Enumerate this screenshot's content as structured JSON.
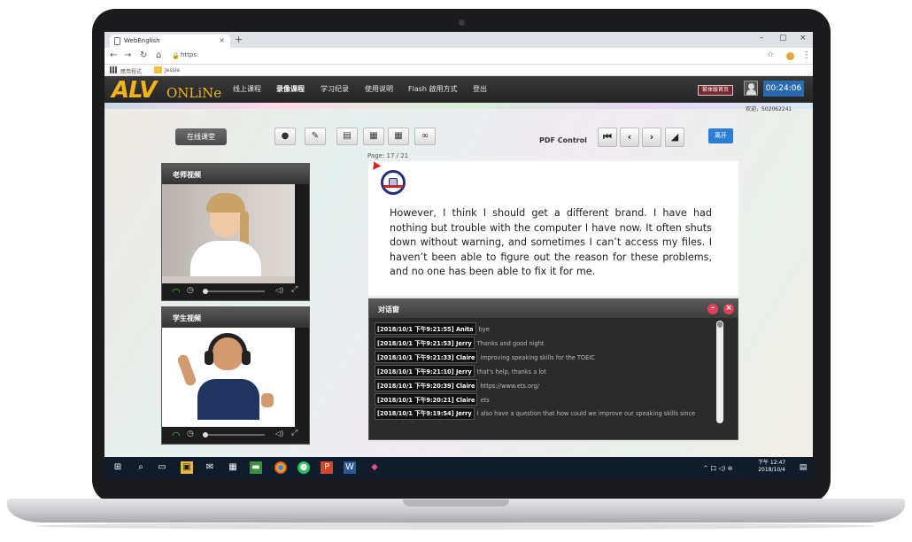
{
  "browser": {
    "tab_title": "WebEnglish",
    "tab_close": "×",
    "new_tab": "+",
    "window_controls": [
      "–",
      "▢",
      "×"
    ],
    "url": "https:",
    "bookmarks": [
      "應用程式",
      "Jessie"
    ]
  },
  "app": {
    "logo_main": "ALV",
    "logo_sub": "ONLiNe",
    "menu": [
      "线上课程",
      "录像课程",
      "学习纪录",
      "使用说明",
      "Flash 啟用方式",
      "登出"
    ],
    "active_menu": "录像课程",
    "home_button": "繁体版首页",
    "timer": "00:24:06",
    "welcome": "欢迎，502062241"
  },
  "toolbar": {
    "classroom_button": "在线课堂",
    "pdf_control_label": "PDF Control",
    "leave_button": "离开",
    "tool_icons": [
      "chat-icon",
      "pen-icon",
      "document-icon",
      "film-icon",
      "film-icon",
      "link-icon"
    ],
    "pdf_icons": [
      "first-page-icon",
      "prev-page-icon",
      "next-page-icon",
      "eraser-icon"
    ]
  },
  "teacher_video": {
    "title": "老师视频"
  },
  "student_video": {
    "title": "学生视频"
  },
  "pdf": {
    "page_indicator": "Page: 17 / 21",
    "text": "However, I think I should get a different brand. I have had nothing but trouble with the computer I have now. It often shuts down without warning, and sometimes I can’t access my files. I haven’t been able to figure out the reason for these problems, and no one has been able to fix it for me."
  },
  "chat": {
    "title": "对话窗",
    "messages": [
      {
        "ts": "[2018/10/1 下午9:21:55] Anita",
        "text": "bye"
      },
      {
        "ts": "[2018/10/1 下午9:21:53] Jerry",
        "text": "Thanks and good night"
      },
      {
        "ts": "[2018/10/1 下午9:21:33] Claire",
        "text": "improving speaking skills for the TOEIC"
      },
      {
        "ts": "[2018/10/1 下午9:21:10] Jerry",
        "text": "that's help, thanks a lot"
      },
      {
        "ts": "[2018/10/1 下午9:20:39] Claire",
        "text": "https://www.ets.org/"
      },
      {
        "ts": "[2018/10/1 下午9:20:21] Claire",
        "text": "ets"
      },
      {
        "ts": "[2018/10/1 下午9:19:54] Jerry",
        "text": "I also have a question that how could we improve our speaking skills since TOEIC including speaking test"
      }
    ]
  },
  "taskbar": {
    "time": "下午 12:47",
    "date": "2018/10/4",
    "tray": "^ 口 ◁) ⊗"
  }
}
